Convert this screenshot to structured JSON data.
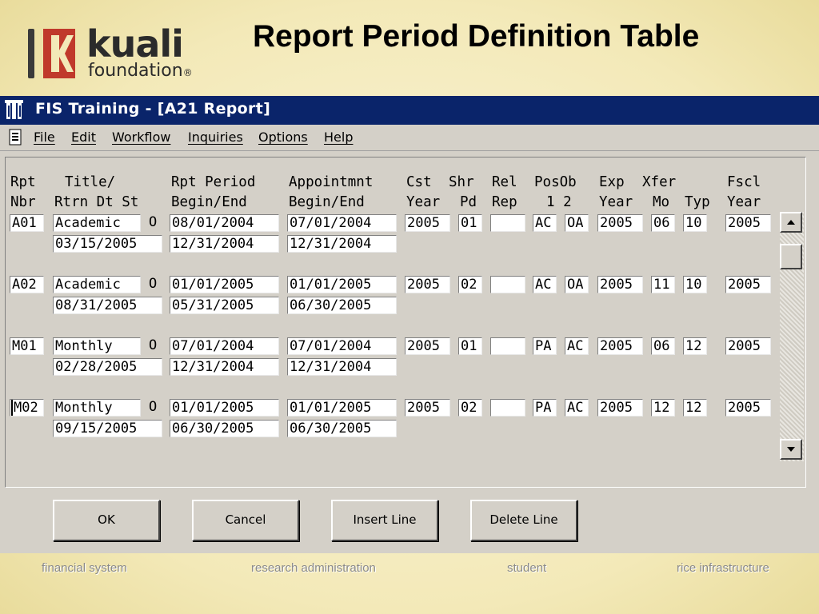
{
  "logo": {
    "word1": "kuali",
    "word2": "foundation",
    "reg": "®"
  },
  "slide_title": "Report Period Definition Table",
  "window": {
    "title": "FIS Training - [A21 Report]"
  },
  "menu": [
    "File",
    "Edit",
    "Workflow",
    "Inquiries",
    "Options",
    "Help"
  ],
  "headers": {
    "line1": [
      "Rpt",
      "Title/",
      "Rpt Period",
      "Appointmnt",
      "Cst",
      "Shr",
      "Rel",
      "PosOb",
      "Exp",
      "Xfer",
      "Fscl"
    ],
    "line2": [
      "Nbr",
      "Rtrn Dt St",
      "Begin/End",
      "Begin/End",
      "Year",
      "Pd",
      "Rep",
      "1 2",
      "Year",
      "Mo",
      "Typ",
      "Year"
    ]
  },
  "rows": [
    {
      "nbr": "A01",
      "title": "Academic",
      "st": "O",
      "rpt_begin": "08/01/2004",
      "appt_begin": "07/01/2004",
      "cst_year": "2005",
      "shr_pd": "01",
      "rel_rep": "",
      "pos1": "AC",
      "pos2": "OA",
      "exp_year": "2005",
      "xfer_mo": "06",
      "typ": "10",
      "fscl_year": "2005",
      "rtrn_dt": "03/15/2005",
      "rpt_end": "12/31/2004",
      "appt_end": "12/31/2004"
    },
    {
      "nbr": "A02",
      "title": "Academic",
      "st": "O",
      "rpt_begin": "01/01/2005",
      "appt_begin": "01/01/2005",
      "cst_year": "2005",
      "shr_pd": "02",
      "rel_rep": "",
      "pos1": "AC",
      "pos2": "OA",
      "exp_year": "2005",
      "xfer_mo": "11",
      "typ": "10",
      "fscl_year": "2005",
      "rtrn_dt": "08/31/2005",
      "rpt_end": "05/31/2005",
      "appt_end": "06/30/2005"
    },
    {
      "nbr": "M01",
      "title": "Monthly",
      "st": "O",
      "rpt_begin": "07/01/2004",
      "appt_begin": "07/01/2004",
      "cst_year": "2005",
      "shr_pd": "01",
      "rel_rep": "",
      "pos1": "PA",
      "pos2": "AC",
      "exp_year": "2005",
      "xfer_mo": "06",
      "typ": "12",
      "fscl_year": "2005",
      "rtrn_dt": "02/28/2005",
      "rpt_end": "12/31/2004",
      "appt_end": "12/31/2004"
    },
    {
      "nbr": "M02",
      "title": "Monthly",
      "st": "O",
      "rpt_begin": "01/01/2005",
      "appt_begin": "01/01/2005",
      "cst_year": "2005",
      "shr_pd": "02",
      "rel_rep": "",
      "pos1": "PA",
      "pos2": "AC",
      "exp_year": "2005",
      "xfer_mo": "12",
      "typ": "12",
      "fscl_year": "2005",
      "rtrn_dt": "09/15/2005",
      "rpt_end": "06/30/2005",
      "appt_end": "06/30/2005"
    }
  ],
  "buttons": {
    "ok": "OK",
    "cancel": "Cancel",
    "insert": "Insert Line",
    "delete": "Delete Line"
  },
  "footer": [
    "financial system",
    "research administration",
    "student",
    "rice infrastructure"
  ],
  "colors": {
    "titlebar": "#0a246a",
    "window_bg": "#d4d0c8",
    "slide_bg": "#f3e9b8",
    "logo_red": "#c0392b"
  }
}
